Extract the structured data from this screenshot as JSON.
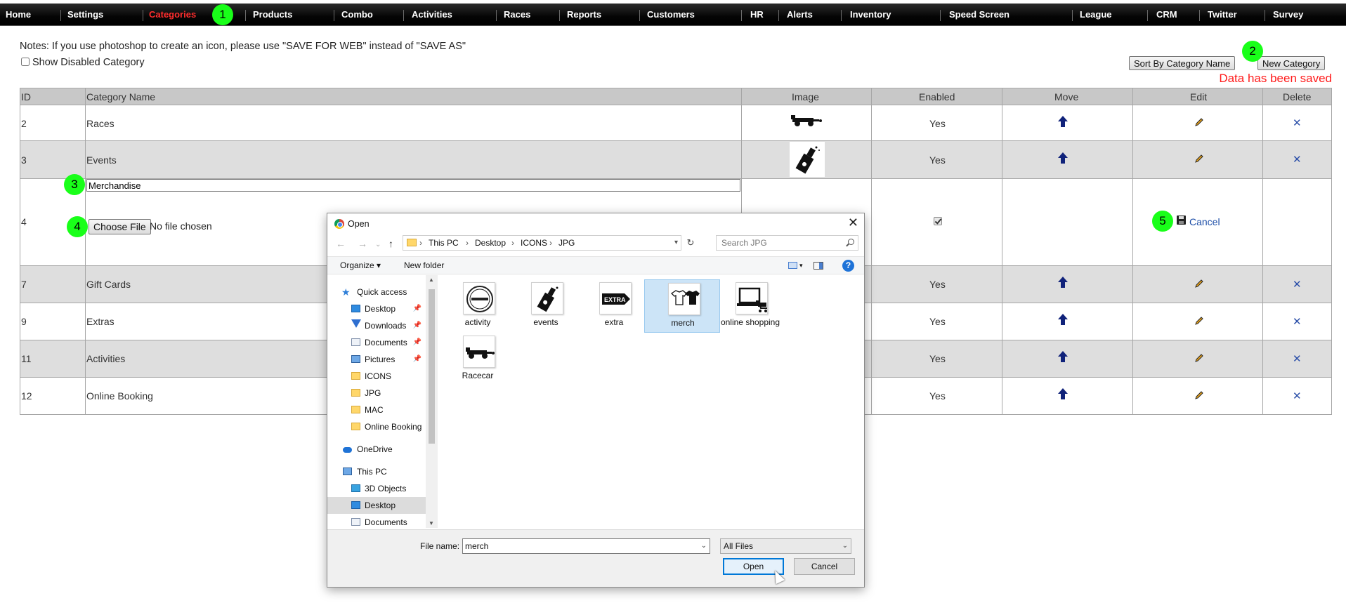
{
  "nav": {
    "items": [
      "Home",
      "Settings",
      "Categories",
      "Products",
      "Combo",
      "Activities",
      "Races",
      "Reports",
      "Customers",
      "HR",
      "Alerts",
      "Inventory",
      "Speed Screen",
      "League",
      "CRM",
      "Twitter",
      "Survey"
    ],
    "active": "Categories"
  },
  "markers": [
    "1",
    "2",
    "3",
    "4",
    "5"
  ],
  "notes": "Notes: If you use photoshop to create an icon, please use \"SAVE FOR WEB\" instead of \"SAVE AS\"",
  "show_disabled_label": "Show Disabled Category",
  "sort_button": "Sort By Category Name",
  "new_category_button": "New Category",
  "saved_message": "Data has been saved",
  "table": {
    "headers": [
      "ID",
      "Category Name",
      "Image",
      "Enabled",
      "Move",
      "Edit",
      "Delete"
    ],
    "rows": [
      {
        "id": "2",
        "name": "Races",
        "enabled": "Yes",
        "image": "racecar-icon"
      },
      {
        "id": "3",
        "name": "Events",
        "enabled": "Yes",
        "image": "champagne-icon"
      },
      {
        "id": "4",
        "name": "Merchandise",
        "enabled": "checked",
        "editing": true
      },
      {
        "id": "7",
        "name": "Gift Cards",
        "enabled": "Yes"
      },
      {
        "id": "9",
        "name": "Extras",
        "enabled": "Yes"
      },
      {
        "id": "11",
        "name": "Activities",
        "enabled": "Yes"
      },
      {
        "id": "12",
        "name": "Online Booking",
        "enabled": "Yes"
      }
    ],
    "edit_row": {
      "name_value": "Merchandise",
      "choose_file": "Choose File",
      "no_file": "No file chosen",
      "cancel": "Cancel"
    }
  },
  "dialog": {
    "title": "Open",
    "breadcrumb": [
      "This PC",
      "Desktop",
      "ICONS",
      "JPG"
    ],
    "search_placeholder": "Search JPG",
    "organize": "Organize ▾",
    "new_folder": "New folder",
    "help": "?",
    "nav_pane": [
      {
        "label": "Quick access",
        "icon": "star-icon",
        "indent": 1
      },
      {
        "label": "Desktop",
        "icon": "desktop-icon",
        "indent": 2,
        "pinned": true
      },
      {
        "label": "Downloads",
        "icon": "download-icon",
        "indent": 2,
        "pinned": true
      },
      {
        "label": "Documents",
        "icon": "documents-icon",
        "indent": 2,
        "pinned": true
      },
      {
        "label": "Pictures",
        "icon": "pictures-icon",
        "indent": 2,
        "pinned": true
      },
      {
        "label": "ICONS",
        "icon": "folder-icon",
        "indent": 2
      },
      {
        "label": "JPG",
        "icon": "folder-icon",
        "indent": 2
      },
      {
        "label": "MAC",
        "icon": "folder-icon",
        "indent": 2
      },
      {
        "label": "Online Booking",
        "icon": "folder-icon",
        "indent": 2
      },
      {
        "label": "OneDrive",
        "icon": "cloud-icon",
        "indent": 1
      },
      {
        "label": "This PC",
        "icon": "pc-icon",
        "indent": 1
      },
      {
        "label": "3D Objects",
        "icon": "cube-icon",
        "indent": 2
      },
      {
        "label": "Desktop",
        "icon": "desktop-icon",
        "indent": 2,
        "selected": true
      },
      {
        "label": "Documents",
        "icon": "documents-icon",
        "indent": 2
      }
    ],
    "files": [
      {
        "label": "activity",
        "icon": "activity-badge-icon"
      },
      {
        "label": "events",
        "icon": "champagne-icon"
      },
      {
        "label": "extra",
        "icon": "extra-tag-icon"
      },
      {
        "label": "merch",
        "icon": "tshirt-icon",
        "selected": true
      },
      {
        "label": "online shopping",
        "icon": "laptop-cart-icon"
      },
      {
        "label": "Racecar",
        "icon": "racecar-icon"
      }
    ],
    "file_name_label": "File name:",
    "file_name_value": "merch",
    "file_type": "All Files",
    "open_button": "Open",
    "cancel_button": "Cancel"
  }
}
